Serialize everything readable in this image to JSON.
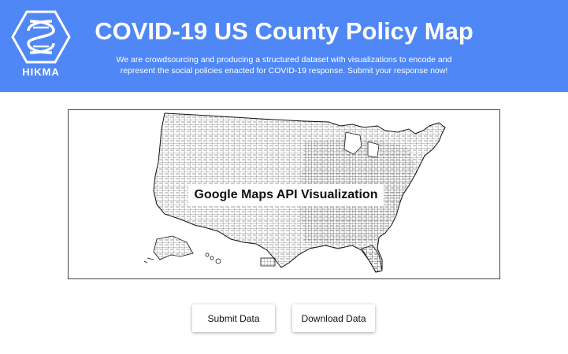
{
  "header": {
    "logo_text": "HIKMA",
    "title": "COVID-19 US County Policy Map",
    "subtitle": "We are crowdsourcing and producing a structured dataset with visualizations to encode and represent the social policies enacted for COVID-19 response. Submit your response now!",
    "background_color": "#4f87f6"
  },
  "map": {
    "label": "Google Maps API Visualization",
    "icon": "us-county-map"
  },
  "actions": {
    "submit_label": "Submit Data",
    "download_label": "Download Data"
  }
}
